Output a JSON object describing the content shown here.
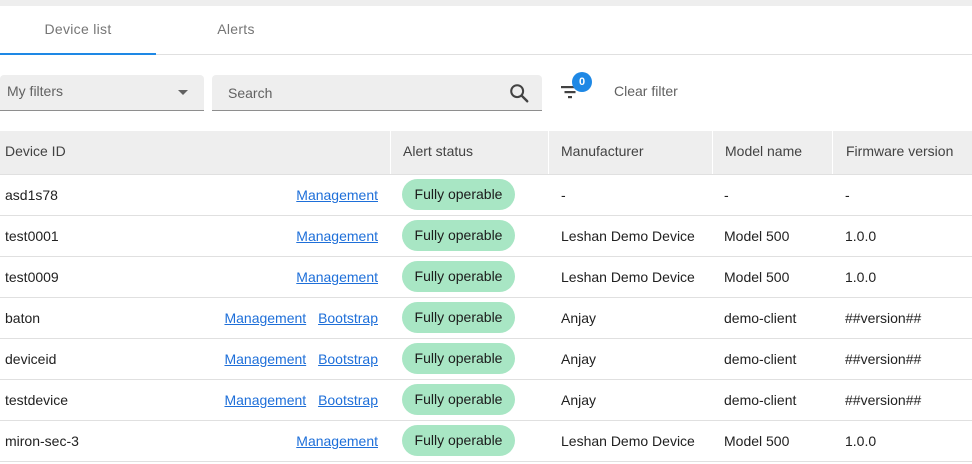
{
  "tabs": [
    {
      "label": "Device list",
      "active": true
    },
    {
      "label": "Alerts",
      "active": false
    }
  ],
  "filters": {
    "my_filters_value": "My filters",
    "search_placeholder": "Search",
    "search_value": "",
    "filter_count": "0",
    "clear_label": "Clear filter"
  },
  "table": {
    "columns": [
      "Device ID",
      "Alert status",
      "Manufacturer",
      "Model name",
      "Firmware version"
    ],
    "rows": [
      {
        "id": "asd1s78",
        "links": [
          "Management"
        ],
        "status": "Fully operable",
        "manufacturer": "-",
        "model": "-",
        "firmware": "-"
      },
      {
        "id": "test0001",
        "links": [
          "Management"
        ],
        "status": "Fully operable",
        "manufacturer": "Leshan Demo Device",
        "model": "Model 500",
        "firmware": "1.0.0"
      },
      {
        "id": "test0009",
        "links": [
          "Management"
        ],
        "status": "Fully operable",
        "manufacturer": "Leshan Demo Device",
        "model": "Model 500",
        "firmware": "1.0.0"
      },
      {
        "id": "baton",
        "links": [
          "Management",
          "Bootstrap"
        ],
        "status": "Fully operable",
        "manufacturer": "Anjay",
        "model": "demo-client",
        "firmware": "##version##"
      },
      {
        "id": "deviceid",
        "links": [
          "Management",
          "Bootstrap"
        ],
        "status": "Fully operable",
        "manufacturer": "Anjay",
        "model": "demo-client",
        "firmware": "##version##"
      },
      {
        "id": "testdevice",
        "links": [
          "Management",
          "Bootstrap"
        ],
        "status": "Fully operable",
        "manufacturer": "Anjay",
        "model": "demo-client",
        "firmware": "##version##"
      },
      {
        "id": "miron-sec-3",
        "links": [
          "Management"
        ],
        "status": "Fully operable",
        "manufacturer": "Leshan Demo Device",
        "model": "Model 500",
        "firmware": "1.0.0"
      }
    ]
  },
  "colors": {
    "accent": "#1e88e5",
    "status_operable": "#a8e6c4",
    "link": "#1e6fd9"
  },
  "icons": [
    "search-icon",
    "filter-list-icon",
    "dropdown-caret-icon"
  ]
}
